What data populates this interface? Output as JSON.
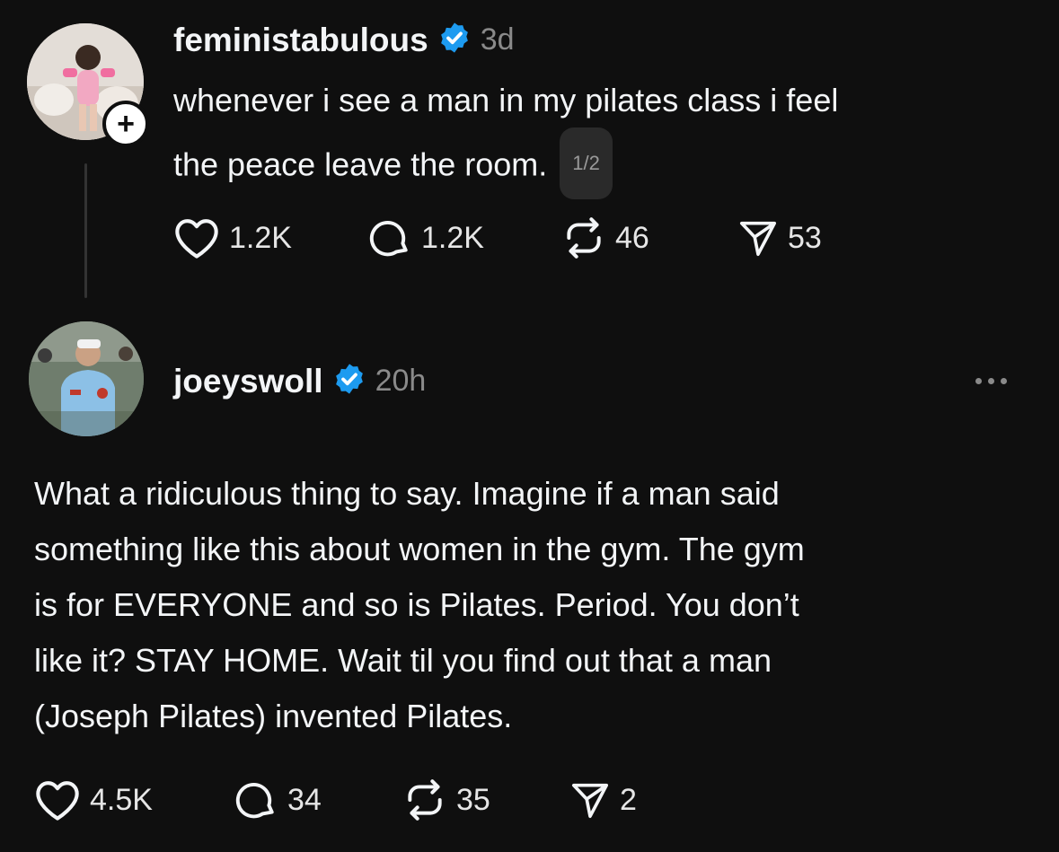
{
  "colors": {
    "background": "#0f0f0f",
    "text": "#f3f5f7",
    "muted": "#8a8a8a",
    "verified": "#1d9bf0"
  },
  "posts": [
    {
      "username": "feministabulous",
      "verified": true,
      "time": "3d",
      "text_lines": [
        "whenever i see a man in my pilates class i feel",
        "the peace leave the room."
      ],
      "thread_counter": "1/2",
      "stats": {
        "likes": "1.2K",
        "replies": "1.2K",
        "reposts": "46",
        "shares": "53"
      },
      "avatar_icon": "profile-photo",
      "follow_icon": "plus-icon"
    },
    {
      "username": "joeyswoll",
      "verified": true,
      "time": "20h",
      "text_lines": [
        "What a ridiculous thing to say. Imagine if a man said",
        "something like this about women in the gym. The gym",
        "is for EVERYONE and so is Pilates. Period. You don’t",
        "like it? STAY HOME. Wait til you find out that a man",
        "(Joseph Pilates) invented Pilates."
      ],
      "stats": {
        "likes": "4.5K",
        "replies": "34",
        "reposts": "35",
        "shares": "2"
      },
      "avatar_icon": "profile-photo",
      "more_icon": "more-options-icon"
    }
  ]
}
